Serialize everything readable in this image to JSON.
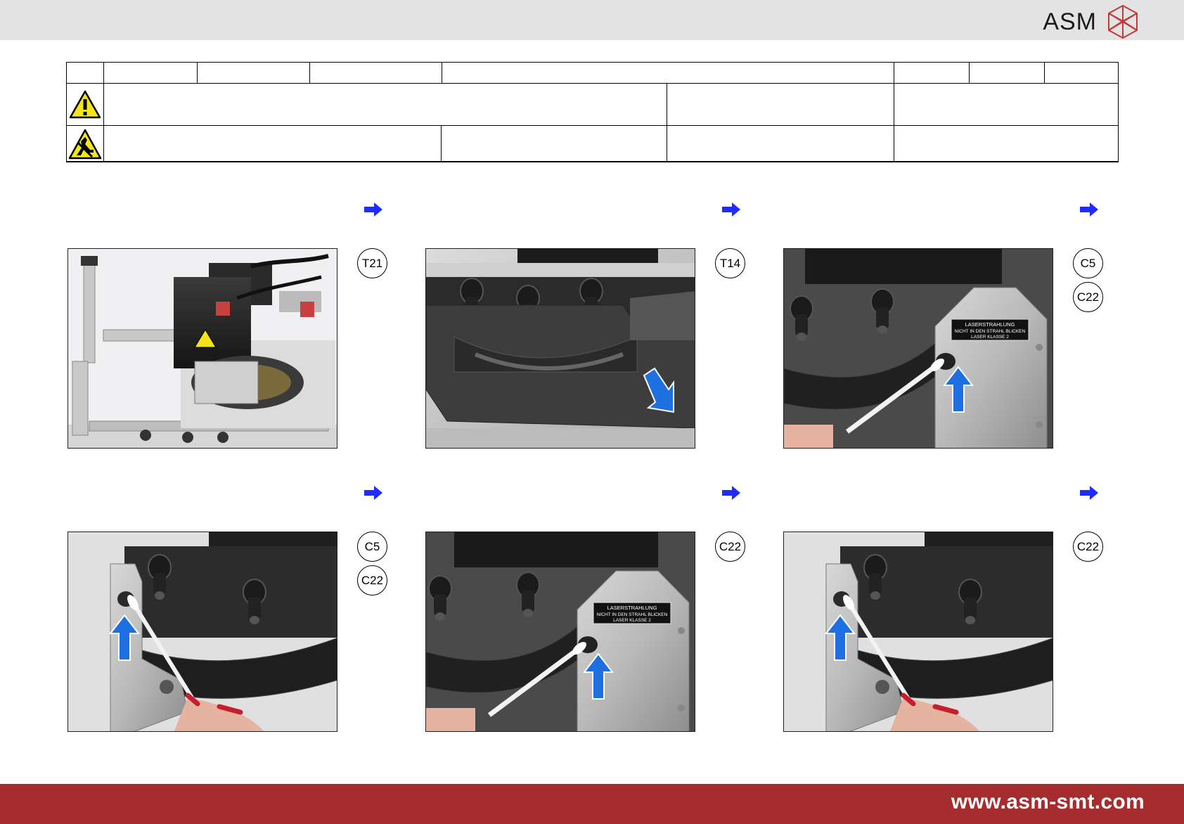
{
  "header": {
    "brand_name": "ASM",
    "logo_icon": "asm-crystal-logo-icon"
  },
  "table": {
    "warning_icon": "general-warning-icon",
    "esd_icon": "esd-sensitive-icon"
  },
  "steps": [
    {
      "arrow_icon": "next-arrow-icon",
      "photo": "placement-head-on-stand-photo",
      "refs": [
        "T21"
      ]
    },
    {
      "arrow_icon": "next-arrow-icon",
      "photo": "remove-cover-plate-photo",
      "refs": [
        "T14"
      ]
    },
    {
      "arrow_icon": "next-arrow-icon",
      "photo": "clean-laser-window-photo",
      "refs": [
        "C5",
        "C22"
      ]
    },
    {
      "arrow_icon": "next-arrow-icon",
      "photo": "clean-left-sensor-photo",
      "refs": [
        "C5",
        "C22"
      ]
    },
    {
      "arrow_icon": "next-arrow-icon",
      "photo": "clean-laser-window-swab-photo",
      "refs": [
        "C22"
      ]
    },
    {
      "arrow_icon": "next-arrow-icon",
      "photo": "clean-left-sensor-swab-photo",
      "refs": [
        "C22"
      ]
    }
  ],
  "labels": {
    "laser_line1": "LASERSTRAHLUNG",
    "laser_line2": "NICHT IN DEN STRAHL BLICKEN",
    "laser_line3": "LASER KLASSE 2"
  },
  "footer": {
    "url": "www.asm-smt.com"
  },
  "colors": {
    "header_bg": "#e3e3e3",
    "footer_bg": "#a72c2d",
    "arrow_blue": "#1f2bff",
    "guide_arrow_blue": "#1e6fe0",
    "logo_red": "#c0393b"
  }
}
